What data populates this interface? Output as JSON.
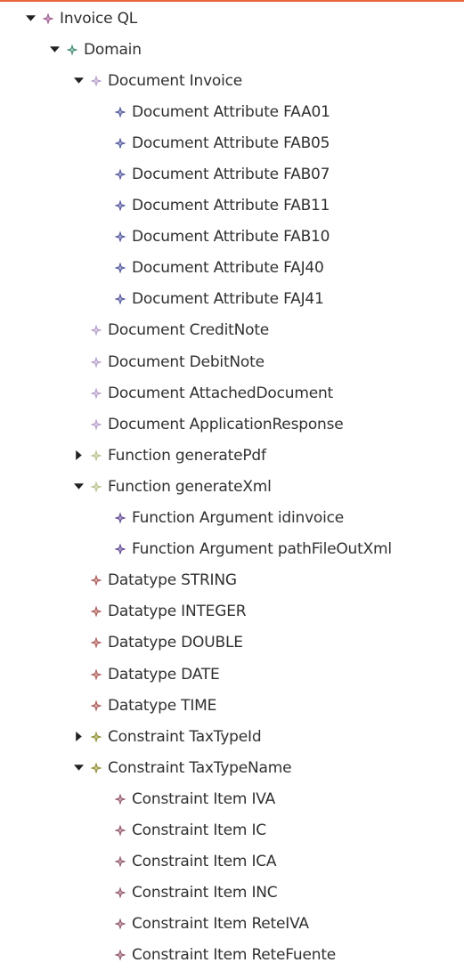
{
  "colors": {
    "accent_rule": "#e8643c",
    "text": "#303030",
    "twisty": "#222222",
    "icon_root": "#9b4f8a",
    "icon_domain": "#3c8a6e",
    "icon_document": "#b39ac8",
    "icon_attribute": "#4b4f9a",
    "icon_function": "#b7bd86",
    "icon_argument": "#5a3d8e",
    "icon_datatype": "#a8504e",
    "icon_constraint": "#8a8a2a",
    "icon_constraint_item": "#8d4e66"
  },
  "tree": {
    "items": [
      {
        "label": "Invoice QL",
        "depth": 0,
        "state": "expanded",
        "icon": "root-diamond-icon",
        "color": "#9b4f8a"
      },
      {
        "label": "Domain",
        "depth": 1,
        "state": "expanded",
        "icon": "domain-diamond-icon",
        "color": "#3c8a6e"
      },
      {
        "label": "Document Invoice",
        "depth": 2,
        "state": "expanded",
        "icon": "document-diamond-icon",
        "color": "#b39ac8"
      },
      {
        "label": "Document Attribute FAA01",
        "depth": 3,
        "state": "leaf",
        "icon": "attribute-diamond-icon",
        "color": "#4b4f9a"
      },
      {
        "label": "Document Attribute FAB05",
        "depth": 3,
        "state": "leaf",
        "icon": "attribute-diamond-icon",
        "color": "#4b4f9a"
      },
      {
        "label": "Document Attribute FAB07",
        "depth": 3,
        "state": "leaf",
        "icon": "attribute-diamond-icon",
        "color": "#4b4f9a"
      },
      {
        "label": "Document Attribute FAB11",
        "depth": 3,
        "state": "leaf",
        "icon": "attribute-diamond-icon",
        "color": "#4b4f9a"
      },
      {
        "label": "Document Attribute FAB10",
        "depth": 3,
        "state": "leaf",
        "icon": "attribute-diamond-icon",
        "color": "#4b4f9a"
      },
      {
        "label": "Document Attribute FAJ40",
        "depth": 3,
        "state": "leaf",
        "icon": "attribute-diamond-icon",
        "color": "#4b4f9a"
      },
      {
        "label": "Document Attribute FAJ41",
        "depth": 3,
        "state": "leaf",
        "icon": "attribute-diamond-icon",
        "color": "#4b4f9a"
      },
      {
        "label": "Document CreditNote",
        "depth": 2,
        "state": "leaf",
        "icon": "document-diamond-icon",
        "color": "#b39ac8"
      },
      {
        "label": "Document DebitNote",
        "depth": 2,
        "state": "leaf",
        "icon": "document-diamond-icon",
        "color": "#b39ac8"
      },
      {
        "label": "Document AttachedDocument",
        "depth": 2,
        "state": "leaf",
        "icon": "document-diamond-icon",
        "color": "#b39ac8"
      },
      {
        "label": "Document ApplicationResponse",
        "depth": 2,
        "state": "leaf",
        "icon": "document-diamond-icon",
        "color": "#b39ac8"
      },
      {
        "label": "Function generatePdf",
        "depth": 2,
        "state": "collapsed",
        "icon": "function-diamond-icon",
        "color": "#b7bd86"
      },
      {
        "label": "Function generateXml",
        "depth": 2,
        "state": "expanded",
        "icon": "function-diamond-icon",
        "color": "#b7bd86"
      },
      {
        "label": "Function Argument idinvoice",
        "depth": 3,
        "state": "leaf",
        "icon": "argument-diamond-icon",
        "color": "#5a3d8e"
      },
      {
        "label": "Function Argument pathFileOutXml",
        "depth": 3,
        "state": "leaf",
        "icon": "argument-diamond-icon",
        "color": "#5a3d8e"
      },
      {
        "label": "Datatype STRING",
        "depth": 2,
        "state": "leaf",
        "icon": "datatype-diamond-icon",
        "color": "#a8504e"
      },
      {
        "label": "Datatype INTEGER",
        "depth": 2,
        "state": "leaf",
        "icon": "datatype-diamond-icon",
        "color": "#a8504e"
      },
      {
        "label": "Datatype DOUBLE",
        "depth": 2,
        "state": "leaf",
        "icon": "datatype-diamond-icon",
        "color": "#a8504e"
      },
      {
        "label": "Datatype DATE",
        "depth": 2,
        "state": "leaf",
        "icon": "datatype-diamond-icon",
        "color": "#a8504e"
      },
      {
        "label": "Datatype TIME",
        "depth": 2,
        "state": "leaf",
        "icon": "datatype-diamond-icon",
        "color": "#a8504e"
      },
      {
        "label": "Constraint TaxTypeId",
        "depth": 2,
        "state": "collapsed",
        "icon": "constraint-diamond-icon",
        "color": "#8a8a2a"
      },
      {
        "label": "Constraint TaxTypeName",
        "depth": 2,
        "state": "expanded",
        "icon": "constraint-diamond-icon",
        "color": "#8a8a2a"
      },
      {
        "label": "Constraint Item IVA",
        "depth": 3,
        "state": "leaf",
        "icon": "constraint-item-diamond-icon",
        "color": "#8d4e66"
      },
      {
        "label": "Constraint Item IC",
        "depth": 3,
        "state": "leaf",
        "icon": "constraint-item-diamond-icon",
        "color": "#8d4e66"
      },
      {
        "label": "Constraint Item ICA",
        "depth": 3,
        "state": "leaf",
        "icon": "constraint-item-diamond-icon",
        "color": "#8d4e66"
      },
      {
        "label": "Constraint Item INC",
        "depth": 3,
        "state": "leaf",
        "icon": "constraint-item-diamond-icon",
        "color": "#8d4e66"
      },
      {
        "label": "Constraint Item ReteIVA",
        "depth": 3,
        "state": "leaf",
        "icon": "constraint-item-diamond-icon",
        "color": "#8d4e66"
      },
      {
        "label": "Constraint Item ReteFuente",
        "depth": 3,
        "state": "leaf",
        "icon": "constraint-item-diamond-icon",
        "color": "#8d4e66"
      }
    ]
  }
}
